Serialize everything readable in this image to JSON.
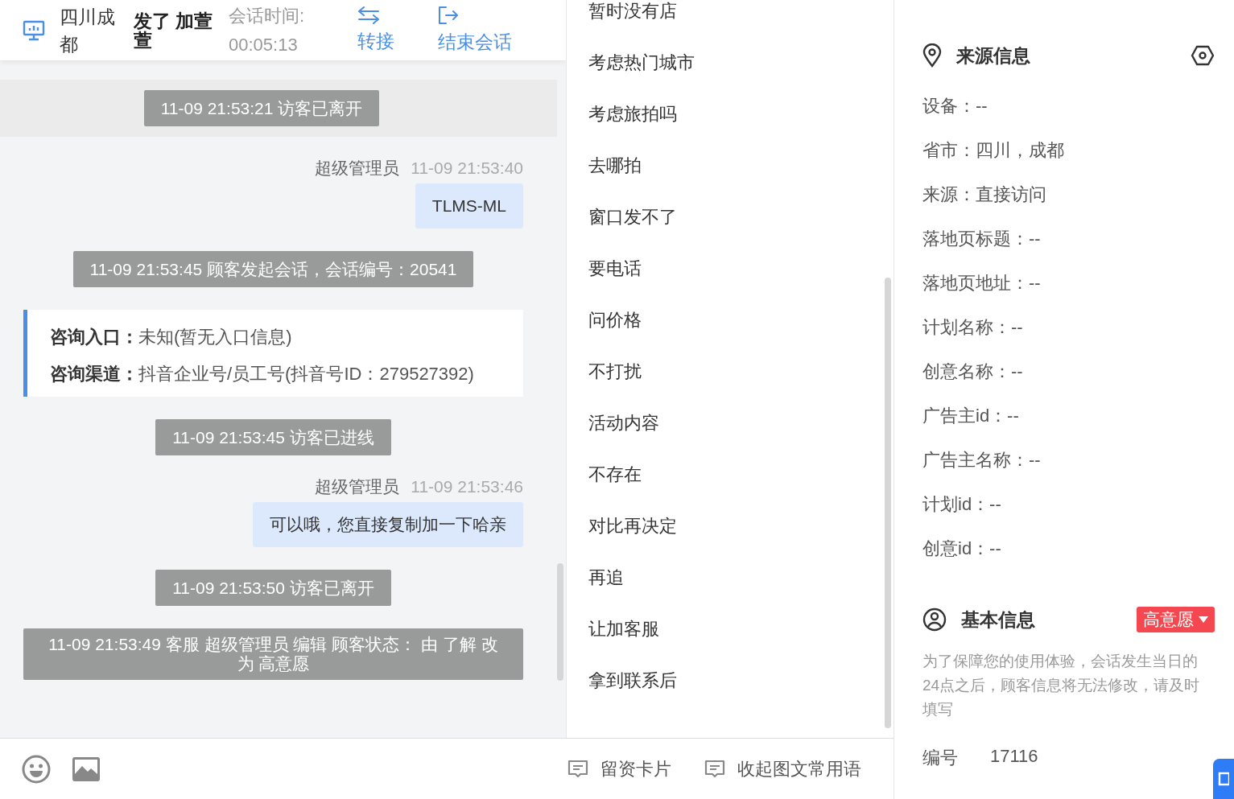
{
  "header": {
    "location": "四川成都",
    "customer": "发了 加萱萱",
    "session_label": "会话时间:",
    "session_time": "00:05:13",
    "actions": [
      {
        "kind": "transfer",
        "label": "转接"
      },
      {
        "kind": "end",
        "label": "结束会话"
      }
    ]
  },
  "chat": {
    "messages": [
      {
        "kind": "system",
        "text": "11-09 21:53:21 访客已离开",
        "highlighted": true
      },
      {
        "kind": "agent",
        "sender": "超级管理员",
        "time": "11-09 21:53:40",
        "text": "TLMS-ML"
      },
      {
        "kind": "system",
        "text": "11-09 21:53:45 顾客发起会话，会话编号：20541",
        "highlighted": false
      },
      {
        "kind": "info",
        "rows": [
          "**咨询入口：**未知(暂无入口信息)",
          "**咨询渠道：**抖音企业号/员工号(抖音号ID：279527392)"
        ]
      },
      {
        "kind": "system",
        "text": "11-09 21:53:45 访客已进线",
        "highlighted": false
      },
      {
        "kind": "agent",
        "sender": "超级管理员",
        "time": "11-09 21:53:46",
        "text": "可以哦，您直接复制加一下哈亲"
      },
      {
        "kind": "system",
        "text": "11-09 21:53:50 访客已离开",
        "highlighted": false
      },
      {
        "kind": "wide",
        "text": "11-09 21:53:49 客服 超级管理员 编辑 顾客状态： 由 了解 改为 高意愿"
      }
    ]
  },
  "quick_replies": [
    "暂时没有店",
    "考虑热门城市",
    "考虑旅拍吗",
    "去哪拍",
    "窗口发不了",
    "要电话",
    "问价格",
    "不打扰",
    "活动内容",
    "不存在",
    "对比再决定",
    "再追",
    "让加客服",
    "拿到联系后"
  ],
  "toolbar": {
    "tools": [
      {
        "kind": "emoji"
      },
      {
        "kind": "image"
      }
    ],
    "actions": [
      {
        "label": "留资卡片"
      },
      {
        "label": "收起图文常用语"
      }
    ]
  },
  "source_info": {
    "title": "来源信息",
    "fields": [
      "设备：--",
      "省市：四川，成都",
      "来源：直接访问",
      "落地页标题：--",
      "落地页地址：--",
      "计划名称：--",
      "创意名称：--",
      "广告主id：--",
      "广告主名称：--",
      "计划id：--",
      "创意id：--"
    ]
  },
  "basic_info": {
    "title": "基本信息",
    "status": {
      "label": "高意愿",
      "color": "#f5474f"
    },
    "notice": "为了保障您的使用体验，会话发生当日的24点之后，顾客信息将无法修改，请及时填写",
    "fields": [
      {
        "label": "编号",
        "value": "17116"
      }
    ]
  }
}
